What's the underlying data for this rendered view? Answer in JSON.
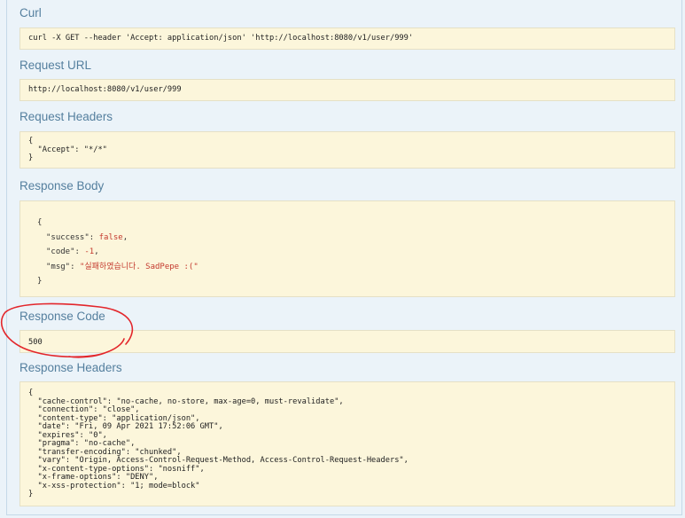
{
  "sections": {
    "curl": {
      "title": "Curl",
      "value": "curl -X GET --header 'Accept: application/json' 'http://localhost:8080/v1/user/999'"
    },
    "request_url": {
      "title": "Request URL",
      "value": "http://localhost:8080/v1/user/999"
    },
    "request_headers": {
      "title": "Request Headers",
      "value": "{\n  \"Accept\": \"*/*\"\n}"
    },
    "response_body": {
      "title": "Response Body",
      "open": "{",
      "close": "}",
      "fields": [
        {
          "key": "\"success\"",
          "value": "false",
          "suffix": ","
        },
        {
          "key": "\"code\"",
          "value": "-1",
          "suffix": ","
        },
        {
          "key": "\"msg\"",
          "value": "\"실패하였습니다. SadPepe :(\"",
          "suffix": ""
        }
      ]
    },
    "response_code": {
      "title": "Response Code",
      "value": "500"
    },
    "response_headers": {
      "title": "Response Headers",
      "value": "{\n  \"cache-control\": \"no-cache, no-store, max-age=0, must-revalidate\",\n  \"connection\": \"close\",\n  \"content-type\": \"application/json\",\n  \"date\": \"Fri, 09 Apr 2021 17:52:06 GMT\",\n  \"expires\": \"0\",\n  \"pragma\": \"no-cache\",\n  \"transfer-encoding\": \"chunked\",\n  \"vary\": \"Origin, Access-Control-Request-Method, Access-Control-Request-Headers\",\n  \"x-content-type-options\": \"nosniff\",\n  \"x-frame-options\": \"DENY\",\n  \"x-xss-protection\": \"1; mode=block\"\n}"
    }
  },
  "colors": {
    "heading": "#547f9e",
    "box_background": "#fcf6db",
    "json_value": "#c43a2e",
    "annotation": "#e3262b"
  }
}
